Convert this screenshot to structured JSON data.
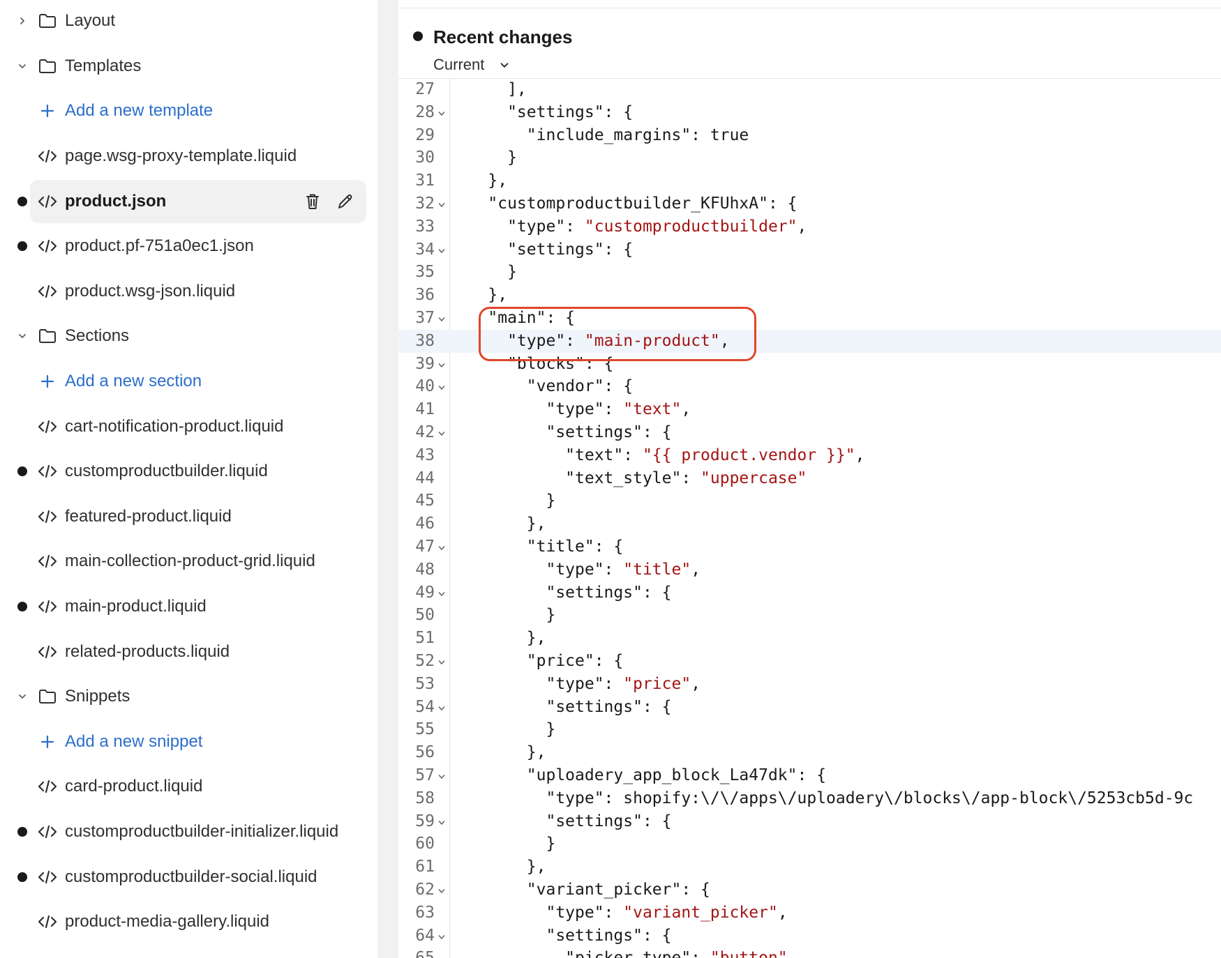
{
  "sidebar": {
    "items": [
      {
        "kind": "folder",
        "label": "Layout",
        "expanded": false,
        "modified": false
      },
      {
        "kind": "folder",
        "label": "Templates",
        "expanded": true,
        "modified": false
      },
      {
        "kind": "add",
        "label": "Add a new template"
      },
      {
        "kind": "file",
        "label": "page.wsg-proxy-template.liquid",
        "modified": false
      },
      {
        "kind": "file",
        "label": "product.json",
        "modified": true,
        "selected": true
      },
      {
        "kind": "file",
        "label": "product.pf-751a0ec1.json",
        "modified": true
      },
      {
        "kind": "file",
        "label": "product.wsg-json.liquid",
        "modified": false
      },
      {
        "kind": "folder",
        "label": "Sections",
        "expanded": true,
        "modified": false
      },
      {
        "kind": "add",
        "label": "Add a new section"
      },
      {
        "kind": "file",
        "label": "cart-notification-product.liquid",
        "modified": false
      },
      {
        "kind": "file",
        "label": "customproductbuilder.liquid",
        "modified": true
      },
      {
        "kind": "file",
        "label": "featured-product.liquid",
        "modified": false
      },
      {
        "kind": "file",
        "label": "main-collection-product-grid.liquid",
        "modified": false
      },
      {
        "kind": "file",
        "label": "main-product.liquid",
        "modified": true
      },
      {
        "kind": "file",
        "label": "related-products.liquid",
        "modified": false
      },
      {
        "kind": "folder",
        "label": "Snippets",
        "expanded": true,
        "modified": false
      },
      {
        "kind": "add",
        "label": "Add a new snippet"
      },
      {
        "kind": "file",
        "label": "card-product.liquid",
        "modified": false
      },
      {
        "kind": "file",
        "label": "customproductbuilder-initializer.liquid",
        "modified": true
      },
      {
        "kind": "file",
        "label": "customproductbuilder-social.liquid",
        "modified": true
      },
      {
        "kind": "file",
        "label": "product-media-gallery.liquid",
        "modified": false
      }
    ],
    "selected_actions": [
      "trash-icon",
      "pencil-icon"
    ]
  },
  "changes": {
    "title": "Recent changes",
    "version": "Current"
  },
  "code": {
    "active_line": 38,
    "lines": [
      {
        "n": 27,
        "fold": false,
        "text": "      ],"
      },
      {
        "n": 28,
        "fold": true,
        "text": "      \"settings\": {"
      },
      {
        "n": 29,
        "fold": false,
        "text": "        \"include_margins\": true"
      },
      {
        "n": 30,
        "fold": false,
        "text": "      }"
      },
      {
        "n": 31,
        "fold": false,
        "text": "    },"
      },
      {
        "n": 32,
        "fold": true,
        "text": "    \"customproductbuilder_KFUhxA\": {"
      },
      {
        "n": 33,
        "fold": false,
        "text": "      \"type\": \"customproductbuilder\","
      },
      {
        "n": 34,
        "fold": true,
        "text": "      \"settings\": {"
      },
      {
        "n": 35,
        "fold": false,
        "text": "      }"
      },
      {
        "n": 36,
        "fold": false,
        "text": "    },"
      },
      {
        "n": 37,
        "fold": true,
        "text": "    \"main\": {"
      },
      {
        "n": 38,
        "fold": false,
        "text": "      \"type\": \"main-product\","
      },
      {
        "n": 39,
        "fold": true,
        "text": "      \"blocks\": {"
      },
      {
        "n": 40,
        "fold": true,
        "text": "        \"vendor\": {"
      },
      {
        "n": 41,
        "fold": false,
        "text": "          \"type\": \"text\","
      },
      {
        "n": 42,
        "fold": true,
        "text": "          \"settings\": {"
      },
      {
        "n": 43,
        "fold": false,
        "text": "            \"text\": \"{{ product.vendor }}\","
      },
      {
        "n": 44,
        "fold": false,
        "text": "            \"text_style\": \"uppercase\""
      },
      {
        "n": 45,
        "fold": false,
        "text": "          }"
      },
      {
        "n": 46,
        "fold": false,
        "text": "        },"
      },
      {
        "n": 47,
        "fold": true,
        "text": "        \"title\": {"
      },
      {
        "n": 48,
        "fold": false,
        "text": "          \"type\": \"title\","
      },
      {
        "n": 49,
        "fold": true,
        "text": "          \"settings\": {"
      },
      {
        "n": 50,
        "fold": false,
        "text": "          }"
      },
      {
        "n": 51,
        "fold": false,
        "text": "        },"
      },
      {
        "n": 52,
        "fold": true,
        "text": "        \"price\": {"
      },
      {
        "n": 53,
        "fold": false,
        "text": "          \"type\": \"price\","
      },
      {
        "n": 54,
        "fold": true,
        "text": "          \"settings\": {"
      },
      {
        "n": 55,
        "fold": false,
        "text": "          }"
      },
      {
        "n": 56,
        "fold": false,
        "text": "        },"
      },
      {
        "n": 57,
        "fold": true,
        "text": "        \"uploadery_app_block_La47dk\": {"
      },
      {
        "n": 58,
        "fold": false,
        "text": "          \"type\": \"shopify:\\/\\/apps\\/uploadery\\/blocks\\/app-block\\/5253cb5d-9c"
      },
      {
        "n": 59,
        "fold": true,
        "text": "          \"settings\": {"
      },
      {
        "n": 60,
        "fold": false,
        "text": "          }"
      },
      {
        "n": 61,
        "fold": false,
        "text": "        },"
      },
      {
        "n": 62,
        "fold": true,
        "text": "        \"variant_picker\": {"
      },
      {
        "n": 63,
        "fold": false,
        "text": "          \"type\": \"variant_picker\","
      },
      {
        "n": 64,
        "fold": true,
        "text": "          \"settings\": {"
      },
      {
        "n": 65,
        "fold": false,
        "text": "            \"picker_type\": \"button\","
      }
    ]
  },
  "colors": {
    "link": "#2c6ecb",
    "string": "#a31515",
    "keyword": "#000080",
    "highlight_border": "#e0462a",
    "active_line": "#f0f5fc"
  }
}
